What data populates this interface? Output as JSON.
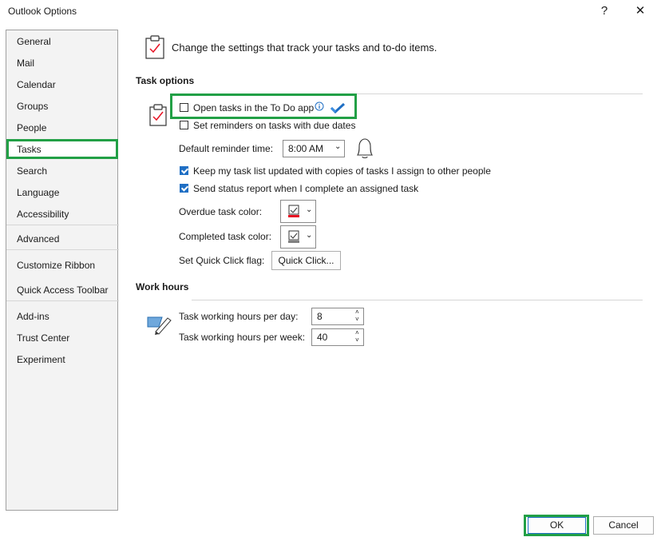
{
  "window": {
    "title": "Outlook Options",
    "help": "?",
    "close": "✕"
  },
  "sidebar": {
    "items": [
      {
        "label": "General"
      },
      {
        "label": "Mail"
      },
      {
        "label": "Calendar"
      },
      {
        "label": "Groups"
      },
      {
        "label": "People"
      },
      {
        "label": "Tasks"
      },
      {
        "label": "Search"
      },
      {
        "label": "Language"
      },
      {
        "label": "Accessibility"
      },
      {
        "label": "Advanced"
      },
      {
        "label": "Customize Ribbon"
      },
      {
        "label": "Quick Access Toolbar"
      },
      {
        "label": "Add-ins"
      },
      {
        "label": "Trust Center"
      },
      {
        "label": "Experiment"
      }
    ],
    "selected": "Tasks"
  },
  "header": {
    "text": "Change the settings that track your tasks and to-do items.",
    "icon": "clipboard-check-icon"
  },
  "task_options": {
    "heading": "Task options",
    "open_in_todo": {
      "label": "Open tasks in the To Do app",
      "checked": false
    },
    "set_reminders": {
      "label": "Set reminders on tasks with due dates",
      "checked": false
    },
    "reminder_time": {
      "label": "Default reminder time:",
      "value": "8:00 AM"
    },
    "keep_updated": {
      "label": "Keep my task list updated with copies of tasks I assign to other people",
      "checked": true
    },
    "send_status": {
      "label": "Send status report when I complete an assigned task",
      "checked": true
    },
    "overdue_color": {
      "label": "Overdue task color:",
      "color": "#e81123"
    },
    "completed_color": {
      "label": "Completed task color:",
      "color": "#808080"
    },
    "quick_click": {
      "label": "Set Quick Click flag:",
      "button": "Quick Click..."
    }
  },
  "work_hours": {
    "heading": "Work hours",
    "per_day": {
      "label": "Task working hours per day:",
      "value": "8"
    },
    "per_week": {
      "label": "Task working hours per week:",
      "value": "40"
    }
  },
  "footer": {
    "ok": "OK",
    "cancel": "Cancel"
  },
  "colors": {
    "accent": "#1f6fc4",
    "highlight": "#22a046"
  }
}
